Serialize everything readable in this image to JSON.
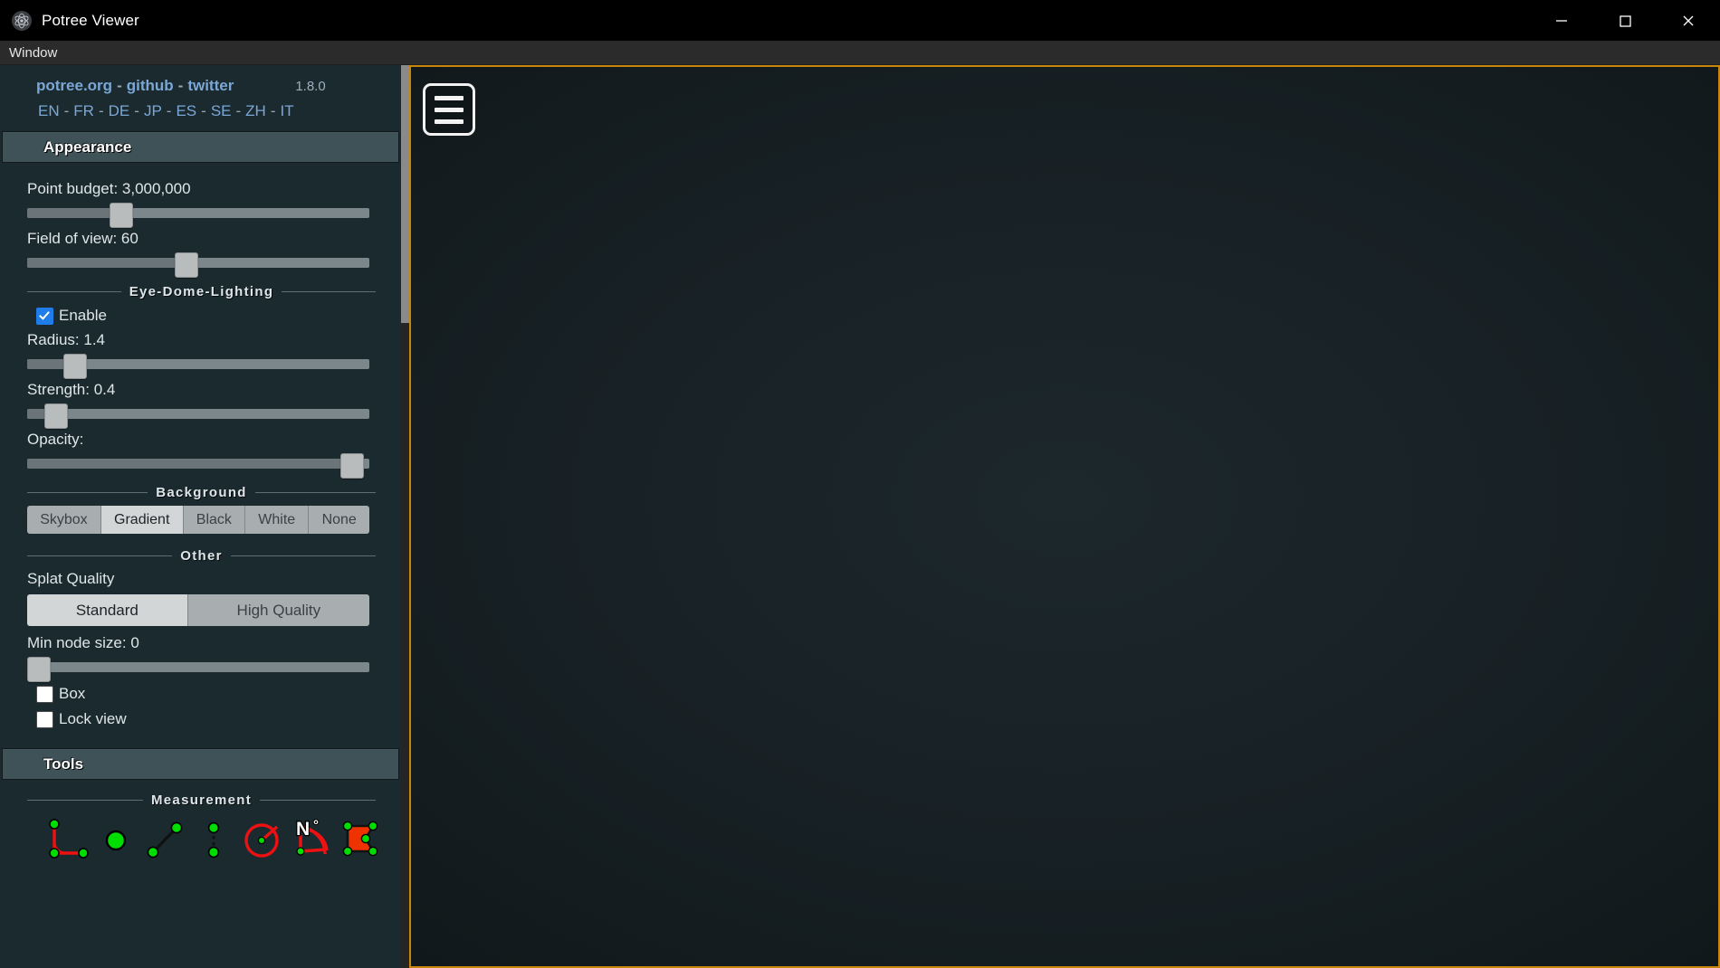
{
  "window": {
    "title": "Potree Viewer",
    "icon": "potree-atom-icon",
    "controls": {
      "minimize": "minimize-icon",
      "maximize": "maximize-icon",
      "close": "close-icon"
    }
  },
  "menubar": {
    "items": [
      "Window"
    ]
  },
  "sidebar": {
    "brand": {
      "links": [
        "potree.org",
        "github",
        "twitter"
      ],
      "separator": "-",
      "version": "1.8.0"
    },
    "languages": [
      "EN",
      "FR",
      "DE",
      "JP",
      "ES",
      "SE",
      "ZH",
      "IT"
    ],
    "lang_separator": "-",
    "sections": {
      "appearance": {
        "title": "Appearance",
        "point_budget": {
          "label": "Point budget: 3,000,000",
          "value": 3000000,
          "percent": 26
        },
        "field_of_view": {
          "label": "Field of view: 60",
          "value": 60,
          "percent": 45
        },
        "edl": {
          "legend": "Eye-Dome-Lighting",
          "enable_label": "Enable",
          "enable_checked": true,
          "radius": {
            "label": "Radius: 1.4",
            "value": 1.4,
            "percent": 12
          },
          "strength": {
            "label": "Strength: 0.4",
            "value": 0.4,
            "percent": 6
          },
          "opacity": {
            "label": "Opacity:",
            "percent": 97
          }
        },
        "background": {
          "legend": "Background",
          "options": [
            "Skybox",
            "Gradient",
            "Black",
            "White",
            "None"
          ],
          "selected": "Gradient"
        },
        "other": {
          "legend": "Other",
          "splat_quality_label": "Splat Quality",
          "splat_quality_options": [
            "Standard",
            "High Quality"
          ],
          "splat_quality_selected": "Standard",
          "min_node_size": {
            "label": "Min node size: 0",
            "value": 0,
            "percent": 0
          },
          "box_label": "Box",
          "box_checked": false,
          "lock_view_label": "Lock view",
          "lock_view_checked": false
        }
      },
      "tools": {
        "title": "Tools",
        "measurement": {
          "legend": "Measurement",
          "tools": [
            "angle-measurement-icon",
            "point-measurement-icon",
            "distance-measurement-icon",
            "height-measurement-icon",
            "circle-measurement-icon",
            "azimuth-measurement-icon",
            "area-measurement-icon"
          ]
        }
      }
    }
  },
  "viewport": {
    "menu_toggle": "hamburger-menu-icon"
  },
  "colors": {
    "accent_border": "#c8860d",
    "link": "#7ba7d7",
    "panel_bg": "#1b2a2f",
    "header_bg": "#3e5257",
    "checkbox_checked": "#1e7de8",
    "measure_red": "#ee1111",
    "measure_green": "#00dd00"
  }
}
